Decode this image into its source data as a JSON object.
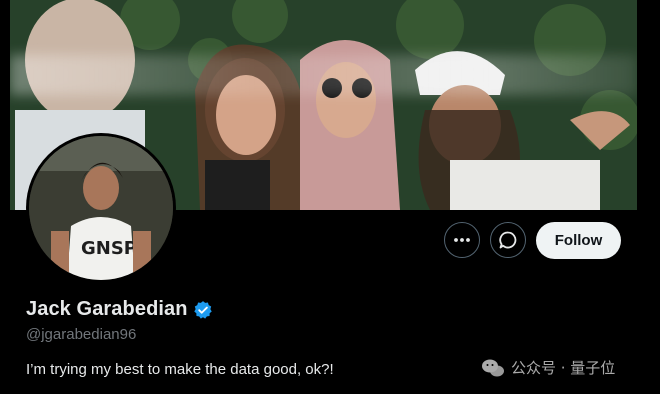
{
  "profile": {
    "display_name": "Jack Garabedian",
    "handle": "@jgarabedian96",
    "bio": "I’m trying my best to make the data good, ok?!",
    "verified": true
  },
  "actions": {
    "more_icon": "more-horizontal-icon",
    "message_icon": "message-bubble-icon",
    "follow_label": "Follow"
  },
  "watermark": {
    "text": "公众号 · 量子位"
  },
  "colors": {
    "background": "#000000",
    "verified_badge": "#1d9bf0",
    "follow_button_bg": "#eff3f4",
    "secondary_text": "#71767b"
  }
}
